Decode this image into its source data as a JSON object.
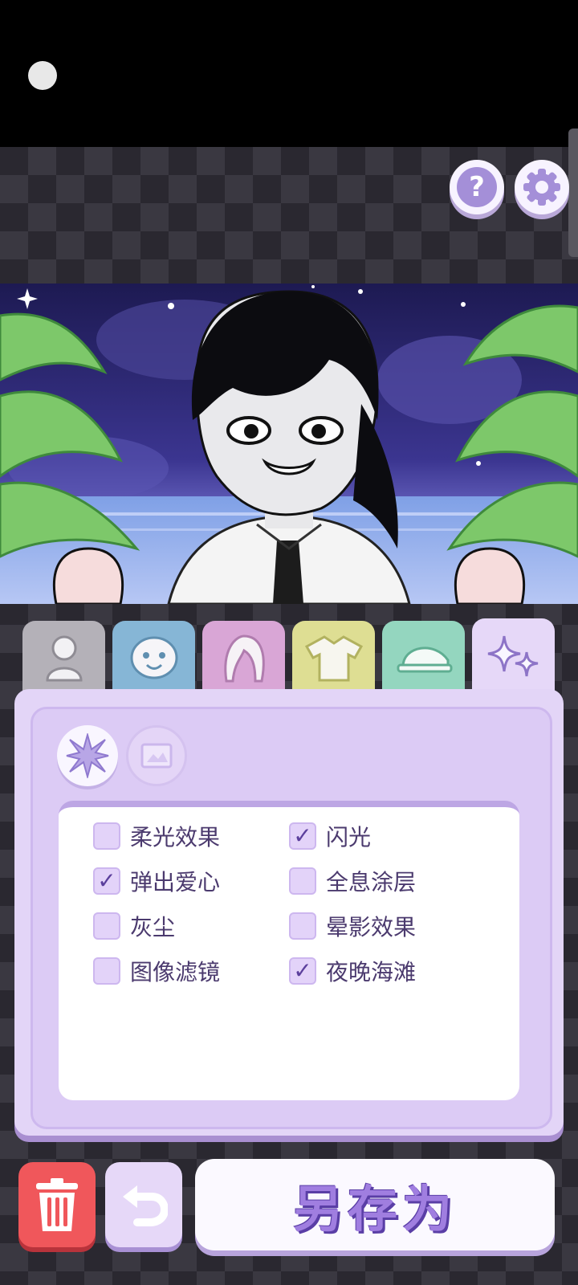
{
  "toolbar": {
    "help_label": "?"
  },
  "tabs": [
    {
      "name": "body",
      "icon": "body-silhouette-icon"
    },
    {
      "name": "face",
      "icon": "face-icon"
    },
    {
      "name": "hair",
      "icon": "hair-icon"
    },
    {
      "name": "clothes",
      "icon": "shirt-icon"
    },
    {
      "name": "hat",
      "icon": "cap-icon"
    },
    {
      "name": "effects",
      "icon": "sparkles-icon",
      "selected": true
    }
  ],
  "sub_tabs": [
    {
      "name": "effects",
      "icon": "star-burst-icon",
      "selected": true
    },
    {
      "name": "background",
      "icon": "picture-frame-icon",
      "selected": false
    }
  ],
  "options": [
    {
      "label": "柔光效果",
      "checked": false
    },
    {
      "label": "闪光",
      "checked": true
    },
    {
      "label": "弹出爱心",
      "checked": true
    },
    {
      "label": "全息涂层",
      "checked": false
    },
    {
      "label": "灰尘",
      "checked": false
    },
    {
      "label": "晕影效果",
      "checked": false
    },
    {
      "label": "图像滤镜",
      "checked": false
    },
    {
      "label": "夜晚海滩",
      "checked": true
    }
  ],
  "actions": {
    "save_label": "另存为"
  },
  "colors": {
    "panel": "#e3d5f7",
    "accent": "#a48fd8",
    "trash": "#f0575b"
  }
}
